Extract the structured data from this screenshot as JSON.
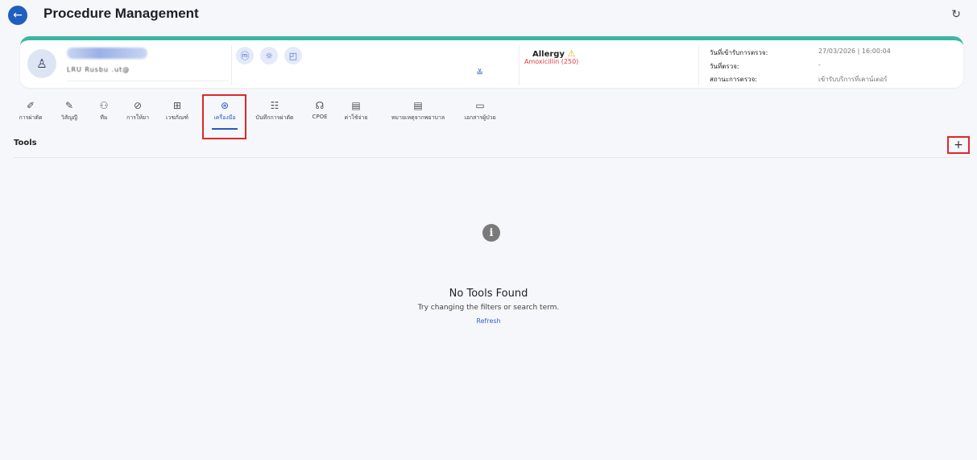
{
  "header": {
    "title": "Procedure Management",
    "back_icon": "←",
    "reload_icon": "↻"
  },
  "patient": {
    "id_text": "LRU Rusbu .ut@",
    "avatar_icon": "♙",
    "action_icons": [
      "ⓜ",
      "☼",
      "◰"
    ],
    "expand_icon": "≚",
    "allergy_label": "Allergy",
    "allergy_warn_icon": "⚠",
    "allergy_drug": "Amoxicillin (250)",
    "info": [
      {
        "label": "วันที่เข้ารับการตรวจ:",
        "value": "27/03/2026 | 16:00:04"
      },
      {
        "label": "วันที่ตรวจ:",
        "value": "-"
      },
      {
        "label": "สถานะการตรวจ:",
        "value": "เข้ารับบริการที่เคาน์เตอร์"
      }
    ]
  },
  "tabs": [
    {
      "label": "การผ่าตัด",
      "icon": "✐"
    },
    {
      "label": "วิสัญญี",
      "icon": "✎"
    },
    {
      "label": "ทีม",
      "icon": "⚇"
    },
    {
      "label": "การให้ยา",
      "icon": "⊘"
    },
    {
      "label": "เวชภัณฑ์",
      "icon": "⊞"
    },
    {
      "label": "เครื่องมือ",
      "icon": "⊛"
    },
    {
      "label": "บันทึกการผ่าตัด",
      "icon": "☷"
    },
    {
      "label": "CPOE",
      "icon": "☊"
    },
    {
      "label": "ค่าใช้จ่าย",
      "icon": "▤"
    },
    {
      "label": "หมายเหตุจากพยาบาล",
      "icon": "▤"
    },
    {
      "label": "เอกสารผู้ป่วย",
      "icon": "▭"
    }
  ],
  "section": {
    "title": "Tools",
    "add_label": "+"
  },
  "empty_state": {
    "icon": "i",
    "title": "No Tools Found",
    "subtitle": "Try changing the filters or search term.",
    "link": "Refresh"
  },
  "colors": {
    "accent": "#2759c3",
    "teal_bar": "#3bb7a5",
    "allergy_red": "#e0393e",
    "highlight_red": "#e0262a"
  }
}
